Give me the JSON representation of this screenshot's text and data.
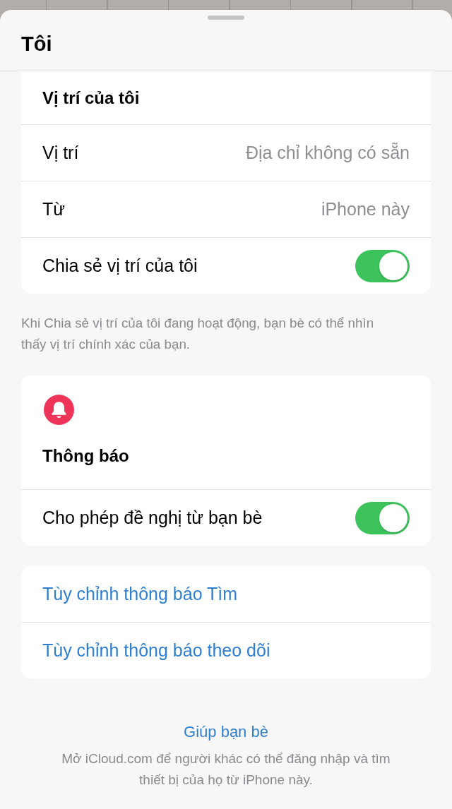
{
  "sheet": {
    "title": "Tôi"
  },
  "sections": [
    {
      "header": {
        "kind": "plain",
        "text": "Vị trí của tôi"
      },
      "rows": [
        {
          "kind": "value",
          "label": "Vị trí",
          "value": "Địa chỉ không có sẵn"
        },
        {
          "kind": "value",
          "label": "Từ",
          "value": "iPhone này"
        },
        {
          "kind": "toggle",
          "label": "Chia sẻ vị trí của tôi",
          "on": true
        }
      ],
      "footer": "Khi Chia sẻ vị trí của tôi đang hoạt động, bạn bè có thể nhìn thấy vị trí chính xác của bạn."
    },
    {
      "header": {
        "kind": "icon",
        "text": "Thông báo"
      },
      "rows": [
        {
          "kind": "toggle",
          "label": "Cho phép đề nghị từ bạn bè",
          "on": true
        }
      ]
    },
    {
      "rows": [
        {
          "kind": "link",
          "label": "Tùy chỉnh thông báo Tìm"
        },
        {
          "kind": "link",
          "label": "Tùy chỉnh thông báo theo dõi"
        }
      ]
    }
  ],
  "help": {
    "link": "Giúp bạn bè",
    "note": "Mở iCloud.com để người khác có thể đăng nhập và tìm thiết bị của họ từ iPhone này."
  }
}
